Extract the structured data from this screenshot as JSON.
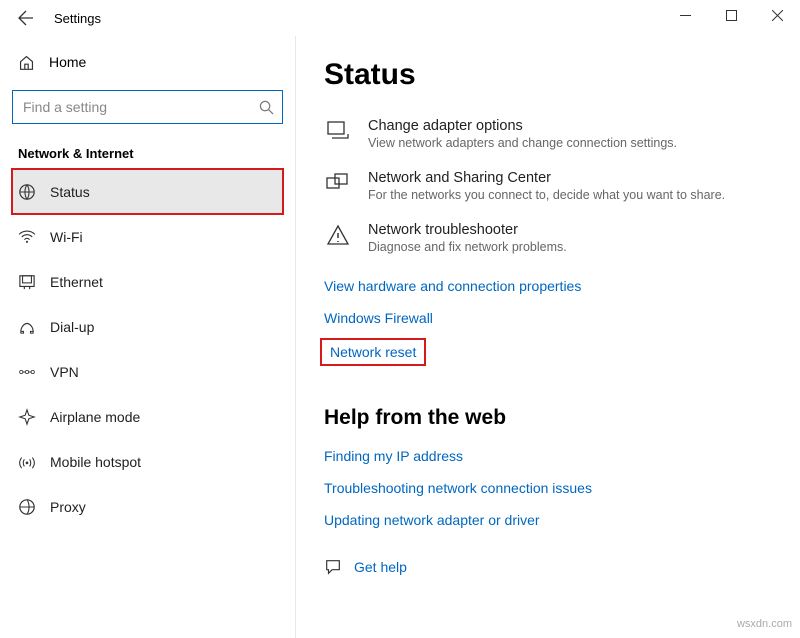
{
  "window": {
    "title": "Settings"
  },
  "sidebar": {
    "home": "Home",
    "search_placeholder": "Find a setting",
    "category": "Network & Internet",
    "items": [
      {
        "label": "Status"
      },
      {
        "label": "Wi-Fi"
      },
      {
        "label": "Ethernet"
      },
      {
        "label": "Dial-up"
      },
      {
        "label": "VPN"
      },
      {
        "label": "Airplane mode"
      },
      {
        "label": "Mobile hotspot"
      },
      {
        "label": "Proxy"
      }
    ]
  },
  "main": {
    "heading": "Status",
    "rows": [
      {
        "title": "Change adapter options",
        "desc": "View network adapters and change connection settings."
      },
      {
        "title": "Network and Sharing Center",
        "desc": "For the networks you connect to, decide what you want to share."
      },
      {
        "title": "Network troubleshooter",
        "desc": "Diagnose and fix network problems."
      }
    ],
    "links": [
      "View hardware and connection properties",
      "Windows Firewall",
      "Network reset"
    ],
    "help_heading": "Help from the web",
    "help_links": [
      "Finding my IP address",
      "Troubleshooting network connection issues",
      "Updating network adapter or driver"
    ],
    "get_help": "Get help"
  },
  "watermark": "wsxdn.com"
}
